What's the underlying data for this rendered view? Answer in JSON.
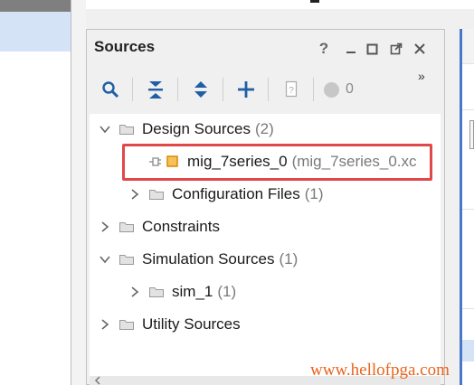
{
  "sources": {
    "title": "Sources",
    "header_icons": [
      "help-icon",
      "minimize-icon",
      "maximize-icon",
      "float-icon",
      "close-icon"
    ],
    "help_glyph": "?",
    "toolbar": {
      "overflow": "»",
      "error_count": "0",
      "icons": [
        "search-icon",
        "collapse-all-icon",
        "expand-all-icon",
        "add-icon",
        "properties-icon",
        "status-circle-icon"
      ]
    },
    "tree": [
      {
        "label": "Design Sources",
        "count": "(2)",
        "expanded": true
      },
      {
        "label": "mig_7series_0",
        "count": "(mig_7series_0.xc",
        "highlighted": true
      },
      {
        "label": "Configuration Files",
        "count": "(1)",
        "expanded": false
      },
      {
        "label": "Constraints",
        "count": "",
        "expanded": false
      },
      {
        "label": "Simulation Sources",
        "count": "(1)",
        "expanded": true
      },
      {
        "label": "sim_1",
        "count": "(1)",
        "expanded": false
      },
      {
        "label": "Utility Sources",
        "count": "",
        "expanded": false
      }
    ]
  },
  "watermark": "www.hellofpga.com",
  "colors": {
    "highlight": "#e0484a",
    "accent": "#4a78c8",
    "watermark": "#e8641c"
  }
}
